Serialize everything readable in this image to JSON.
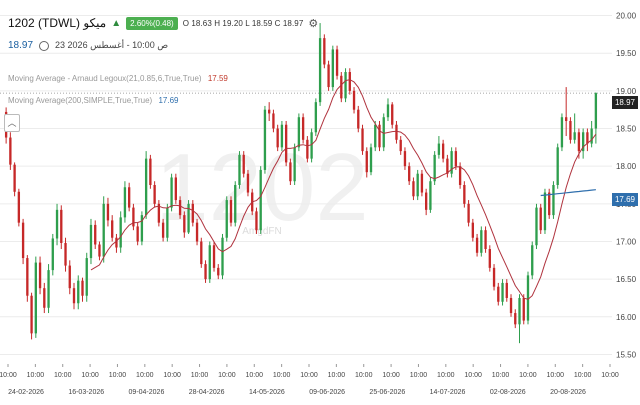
{
  "header": {
    "symbol": "1202  (TDWL)  ميكو",
    "change_badge": "2.60%(0.48)",
    "ohlc": "O  18.63  H  19.20  L  18.59  C  18.97",
    "last_price": "18.97",
    "timestamp": "23 ص 10:00 - أغسطس 2026"
  },
  "indicators": [
    {
      "label": "Moving Average - Arnaud Legoux(21,0.85,6,True,True)",
      "value": "17.59",
      "color": "#c0392b"
    },
    {
      "label": "Moving Average(200,SIMPLE,True,True)",
      "value": "17.69",
      "color": "#2f6fad"
    }
  ],
  "watermark": "1202",
  "watermark_small": "AmgdFN",
  "price_labels": {
    "last": "18.97",
    "sma": "17.69"
  },
  "colors": {
    "up": "#2e9e4d",
    "down": "#c62828",
    "alma": "#b0333e",
    "sma": "#2f6fad"
  },
  "chart_data": {
    "type": "candlestick",
    "ylim": [
      15.4,
      20.1
    ],
    "y_ticks": [
      "20.00",
      "19.50",
      "19.00",
      "18.50",
      "18.00",
      "17.50",
      "17.00",
      "16.50",
      "16.00",
      "15.50"
    ],
    "x_tick_times": [
      "10:00",
      "10:00",
      "10:00",
      "10:00",
      "10:00",
      "10:00",
      "10:00",
      "10:00",
      "10:00",
      "10:00",
      "10:00",
      "10:00",
      "10:00",
      "10:00",
      "10:00",
      "10:00",
      "10:00",
      "10:00",
      "10:00",
      "10:00",
      "10:00",
      "10:00",
      "10:00"
    ],
    "x_tick_dates": [
      "24-02-2026",
      "16-03-2026",
      "09-04-2026",
      "28-04-2026",
      "14-05-2026",
      "09-06-2026",
      "25-06-2026",
      "14-07-2026",
      "02-08-2026",
      "20-08-2026"
    ],
    "ohlc": [
      [
        18.72,
        18.78,
        18.3,
        18.38
      ],
      [
        18.38,
        18.45,
        17.95,
        18.02
      ],
      [
        18.02,
        18.05,
        17.6,
        17.66
      ],
      [
        17.66,
        17.7,
        17.2,
        17.25
      ],
      [
        17.25,
        17.3,
        16.7,
        16.78
      ],
      [
        16.78,
        16.82,
        16.2,
        16.28
      ],
      [
        16.28,
        16.32,
        15.7,
        15.78
      ],
      [
        15.78,
        16.8,
        15.72,
        16.72
      ],
      [
        16.72,
        16.8,
        16.3,
        16.38
      ],
      [
        16.38,
        16.45,
        16.05,
        16.12
      ],
      [
        16.12,
        16.7,
        16.05,
        16.62
      ],
      [
        16.62,
        17.1,
        16.55,
        17.04
      ],
      [
        17.04,
        17.5,
        16.95,
        17.42
      ],
      [
        17.42,
        17.48,
        16.9,
        16.98
      ],
      [
        16.98,
        17.05,
        16.6,
        16.68
      ],
      [
        16.68,
        16.75,
        16.3,
        16.38
      ],
      [
        16.38,
        16.45,
        16.1,
        16.18
      ],
      [
        16.18,
        16.55,
        16.1,
        16.48
      ],
      [
        16.48,
        16.52,
        16.2,
        16.28
      ],
      [
        16.28,
        16.85,
        16.2,
        16.78
      ],
      [
        16.78,
        17.3,
        16.7,
        17.22
      ],
      [
        17.22,
        17.28,
        16.9,
        16.96
      ],
      [
        16.96,
        17.0,
        16.75,
        16.8
      ],
      [
        16.8,
        17.6,
        16.72,
        17.5
      ],
      [
        17.5,
        17.58,
        17.2,
        17.28
      ],
      [
        17.28,
        17.35,
        17.0,
        17.05
      ],
      [
        17.05,
        17.1,
        16.85,
        16.92
      ],
      [
        16.92,
        17.4,
        16.85,
        17.32
      ],
      [
        17.32,
        17.8,
        17.25,
        17.72
      ],
      [
        17.72,
        17.78,
        17.4,
        17.45
      ],
      [
        17.45,
        17.5,
        17.15,
        17.2
      ],
      [
        17.2,
        17.25,
        16.95,
        17.0
      ],
      [
        17.0,
        17.4,
        16.95,
        17.35
      ],
      [
        17.35,
        18.2,
        17.3,
        18.1
      ],
      [
        18.1,
        18.15,
        17.7,
        17.75
      ],
      [
        17.75,
        17.8,
        17.45,
        17.5
      ],
      [
        17.5,
        17.55,
        17.2,
        17.25
      ],
      [
        17.25,
        17.3,
        17.0,
        17.05
      ],
      [
        17.05,
        17.5,
        17.0,
        17.45
      ],
      [
        17.45,
        17.9,
        17.4,
        17.85
      ],
      [
        17.85,
        17.9,
        17.5,
        17.55
      ],
      [
        17.55,
        17.6,
        17.3,
        17.35
      ],
      [
        17.35,
        17.4,
        17.05,
        17.12
      ],
      [
        17.12,
        17.55,
        17.1,
        17.5
      ],
      [
        17.5,
        17.55,
        17.2,
        17.25
      ],
      [
        17.25,
        17.3,
        16.95,
        17.0
      ],
      [
        17.0,
        17.05,
        16.65,
        16.7
      ],
      [
        16.7,
        16.75,
        16.45,
        16.5
      ],
      [
        16.5,
        17.0,
        16.45,
        16.95
      ],
      [
        16.95,
        17.0,
        16.6,
        16.65
      ],
      [
        16.65,
        16.7,
        16.5,
        16.55
      ],
      [
        16.55,
        17.1,
        16.5,
        17.05
      ],
      [
        17.05,
        17.6,
        17.0,
        17.55
      ],
      [
        17.55,
        17.6,
        17.2,
        17.25
      ],
      [
        17.25,
        17.8,
        17.2,
        17.75
      ],
      [
        17.75,
        18.2,
        17.7,
        18.15
      ],
      [
        18.15,
        18.2,
        17.85,
        17.9
      ],
      [
        17.9,
        17.95,
        17.6,
        17.65
      ],
      [
        17.65,
        17.7,
        17.35,
        17.4
      ],
      [
        17.4,
        17.45,
        17.1,
        17.15
      ],
      [
        17.15,
        18.0,
        17.1,
        17.95
      ],
      [
        17.95,
        18.8,
        17.9,
        18.75
      ],
      [
        18.75,
        18.85,
        18.6,
        18.7
      ],
      [
        18.7,
        18.75,
        18.45,
        18.5
      ],
      [
        18.5,
        18.55,
        18.2,
        18.25
      ],
      [
        18.25,
        18.6,
        18.2,
        18.55
      ],
      [
        18.55,
        18.6,
        18.0,
        18.05
      ],
      [
        18.05,
        18.1,
        17.75,
        17.8
      ],
      [
        17.8,
        18.3,
        17.75,
        18.25
      ],
      [
        18.25,
        18.7,
        18.2,
        18.65
      ],
      [
        18.65,
        18.7,
        18.3,
        18.35
      ],
      [
        18.35,
        18.4,
        18.05,
        18.1
      ],
      [
        18.1,
        18.5,
        18.05,
        18.45
      ],
      [
        18.45,
        18.9,
        18.4,
        18.85
      ],
      [
        18.85,
        19.9,
        18.8,
        19.7
      ],
      [
        19.7,
        19.75,
        19.3,
        19.35
      ],
      [
        19.35,
        19.4,
        19.0,
        19.05
      ],
      [
        19.05,
        19.6,
        19.0,
        19.55
      ],
      [
        19.55,
        19.6,
        19.15,
        19.2
      ],
      [
        19.2,
        19.25,
        18.85,
        18.9
      ],
      [
        18.9,
        19.3,
        18.85,
        19.25
      ],
      [
        19.25,
        19.3,
        18.95,
        19.0
      ],
      [
        19.0,
        19.05,
        18.7,
        18.75
      ],
      [
        18.75,
        18.8,
        18.45,
        18.5
      ],
      [
        18.5,
        18.55,
        18.15,
        18.2
      ],
      [
        18.2,
        18.25,
        17.85,
        17.92
      ],
      [
        17.92,
        18.3,
        17.88,
        18.25
      ],
      [
        18.25,
        18.6,
        18.2,
        18.55
      ],
      [
        18.55,
        18.6,
        18.2,
        18.25
      ],
      [
        18.25,
        18.7,
        18.2,
        18.65
      ],
      [
        18.65,
        18.9,
        18.6,
        18.82
      ],
      [
        18.82,
        18.85,
        18.5,
        18.55
      ],
      [
        18.55,
        18.6,
        18.3,
        18.35
      ],
      [
        18.35,
        18.4,
        18.15,
        18.2
      ],
      [
        18.2,
        18.25,
        17.95,
        18.0
      ],
      [
        18.0,
        18.05,
        17.75,
        17.8
      ],
      [
        17.8,
        17.85,
        17.55,
        17.6
      ],
      [
        17.6,
        17.95,
        17.55,
        17.9
      ],
      [
        17.9,
        17.95,
        17.6,
        17.65
      ],
      [
        17.65,
        17.7,
        17.35,
        17.42
      ],
      [
        17.42,
        17.85,
        17.38,
        17.8
      ],
      [
        17.8,
        18.2,
        17.75,
        18.15
      ],
      [
        18.15,
        18.4,
        18.1,
        18.3
      ],
      [
        18.3,
        18.35,
        18.05,
        18.1
      ],
      [
        18.1,
        18.15,
        17.85,
        17.9
      ],
      [
        17.9,
        18.25,
        17.85,
        18.2
      ],
      [
        18.2,
        18.25,
        17.95,
        18.0
      ],
      [
        18.0,
        18.05,
        17.7,
        17.75
      ],
      [
        17.75,
        17.8,
        17.45,
        17.5
      ],
      [
        17.5,
        17.55,
        17.2,
        17.25
      ],
      [
        17.25,
        17.3,
        17.0,
        17.05
      ],
      [
        17.05,
        17.1,
        16.8,
        16.85
      ],
      [
        16.85,
        17.2,
        16.8,
        17.15
      ],
      [
        17.15,
        17.2,
        16.85,
        16.9
      ],
      [
        16.9,
        16.95,
        16.6,
        16.65
      ],
      [
        16.65,
        16.7,
        16.35,
        16.4
      ],
      [
        16.4,
        16.45,
        16.15,
        16.2
      ],
      [
        16.2,
        16.5,
        16.15,
        16.45
      ],
      [
        16.45,
        16.5,
        16.2,
        16.25
      ],
      [
        16.25,
        16.3,
        16.0,
        16.05
      ],
      [
        16.05,
        16.1,
        15.85,
        15.9
      ],
      [
        15.9,
        16.3,
        15.65,
        16.25
      ],
      [
        16.25,
        16.3,
        15.9,
        15.95
      ],
      [
        15.95,
        16.6,
        15.9,
        16.55
      ],
      [
        16.55,
        17.0,
        16.5,
        16.95
      ],
      [
        16.95,
        17.5,
        16.9,
        17.45
      ],
      [
        17.45,
        17.5,
        17.1,
        17.15
      ],
      [
        17.15,
        17.7,
        17.1,
        17.65
      ],
      [
        17.65,
        17.7,
        17.3,
        17.35
      ],
      [
        17.35,
        17.8,
        17.3,
        17.75
      ],
      [
        17.75,
        18.3,
        17.7,
        18.25
      ],
      [
        18.25,
        18.7,
        18.2,
        18.65
      ],
      [
        18.65,
        19.05,
        18.4,
        18.6
      ],
      [
        18.6,
        18.65,
        18.3,
        18.35
      ],
      [
        18.35,
        18.7,
        18.3,
        18.45
      ],
      [
        18.45,
        18.5,
        18.1,
        18.2
      ],
      [
        18.2,
        18.5,
        18.1,
        18.45
      ],
      [
        18.45,
        18.5,
        18.2,
        18.3
      ],
      [
        18.3,
        18.6,
        18.25,
        18.5
      ],
      [
        18.5,
        18.98,
        18.3,
        18.97
      ]
    ]
  }
}
